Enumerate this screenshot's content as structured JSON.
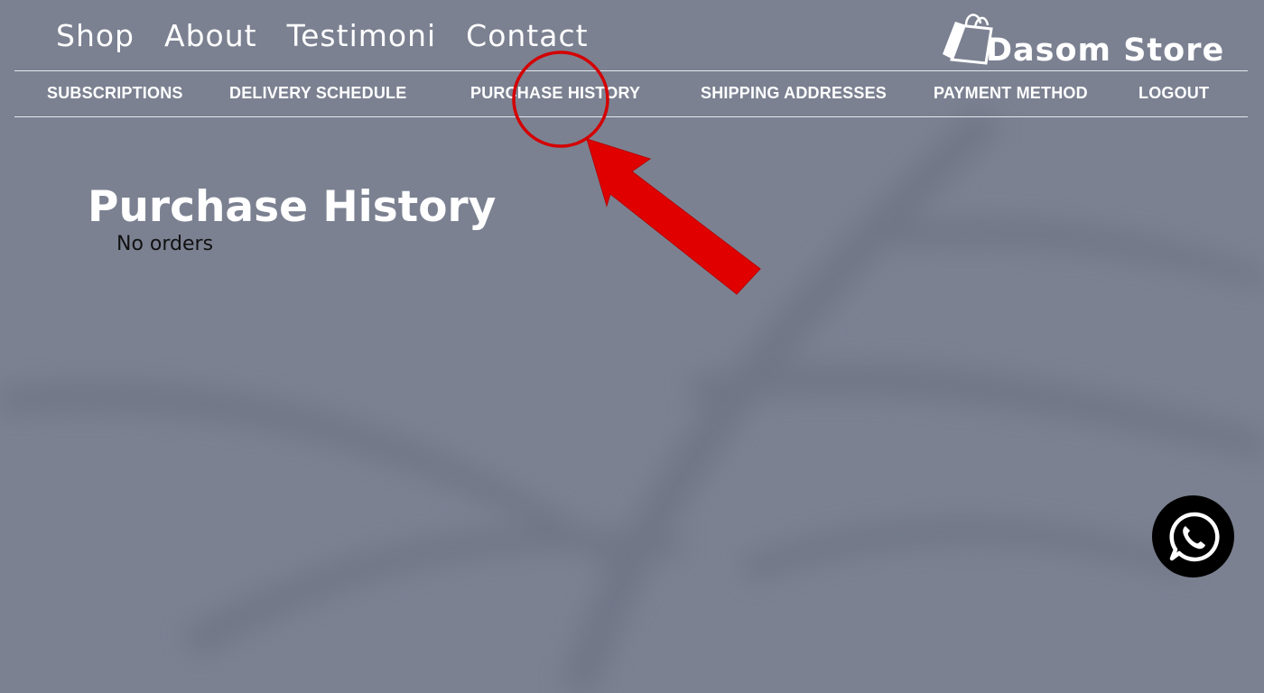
{
  "top_nav": {
    "shop": "Shop",
    "about": "About",
    "testimoni": "Testimoni",
    "contact": "Contact"
  },
  "logo": {
    "text": "Dasom Store",
    "icon": "shopping-bag-icon"
  },
  "account_nav": {
    "subscriptions": "SUBSCRIPTIONS",
    "delivery_schedule": "DELIVERY SCHEDULE",
    "purchase_history": "PURCHASE HISTORY",
    "shipping_addresses": "SHIPPING ADDRESSES",
    "payment_method": "PAYMENT METHOD",
    "logout": "LOGOUT"
  },
  "main": {
    "title": "Purchase History",
    "empty_message": "No orders"
  },
  "chat_button": {
    "icon": "whatsapp-icon"
  },
  "colors": {
    "background": "#7b8191",
    "text": "#ffffff",
    "annotation": "#d40000",
    "chat_button": "#000000"
  }
}
